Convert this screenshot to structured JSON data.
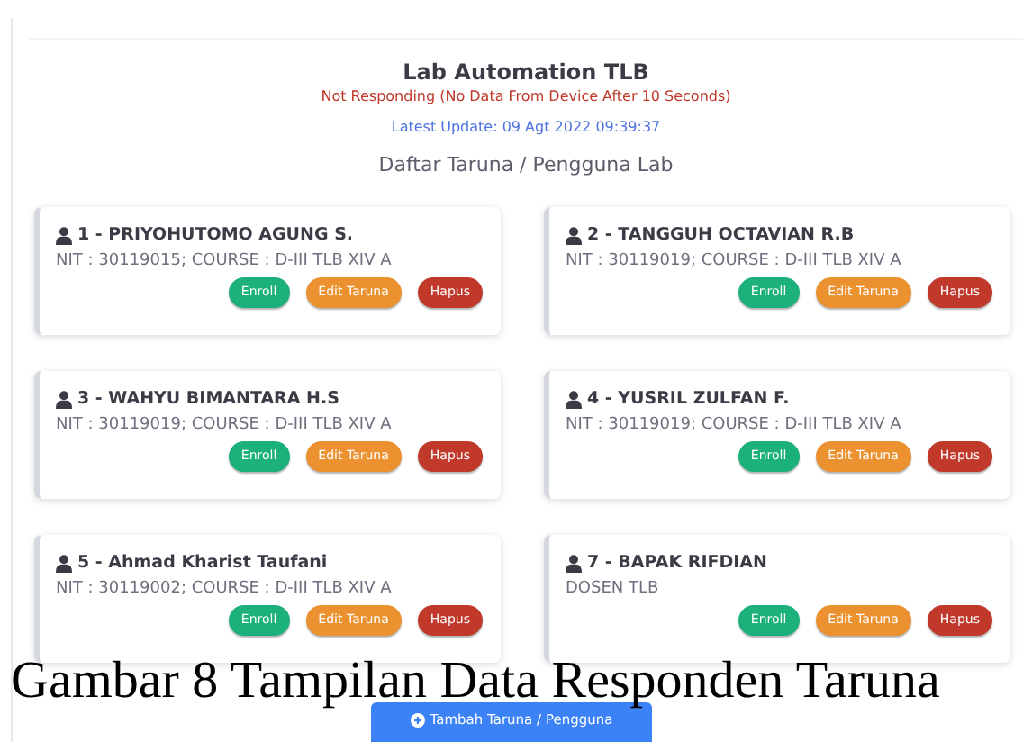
{
  "header": {
    "title": "Lab Automation TLB",
    "status": "Not Responding (No Data From Device After 10 Seconds)",
    "latest_update": "Latest Update: 09 Agt 2022 09:39:37",
    "subtitle": "Daftar Taruna / Pengguna Lab"
  },
  "users": [
    {
      "name": "1 - PRIYOHUTOMO AGUNG S.",
      "detail": "NIT : 30119015; COURSE : D-III TLB XIV A",
      "buttons": [
        "Enroll",
        "Edit Taruna",
        "Hapus"
      ]
    },
    {
      "name": "2 - TANGGUH OCTAVIAN R.B",
      "detail": "NIT : 30119019; COURSE : D-III TLB XIV A",
      "buttons": [
        "Enroll",
        "Edit Taruna",
        "Hapus"
      ]
    },
    {
      "name": "3 - WAHYU BIMANTARA H.S",
      "detail": "NIT : 30119019; COURSE : D-III TLB XIV A",
      "buttons": [
        "Enroll",
        "Edit Taruna",
        "Hapus"
      ]
    },
    {
      "name": "4 - YUSRIL ZULFAN F.",
      "detail": "NIT : 30119019; COURSE : D-III TLB XIV A",
      "buttons": [
        "Enroll",
        "Edit Taruna",
        "Hapus"
      ]
    },
    {
      "name": "5 - Ahmad Kharist Taufani",
      "detail": "NIT : 30119002; COURSE : D-III TLB XIV A",
      "buttons": [
        "Enroll",
        "Edit Taruna",
        "Hapus"
      ]
    },
    {
      "name": "7 - BAPAK RIFDIAN",
      "detail": "DOSEN TLB",
      "buttons": [
        "Enroll",
        "Edit Taruna",
        "Hapus"
      ]
    }
  ],
  "add_button": "Tambah Taruna / Pengguna",
  "caption": "Gambar 8 Tampilan Data Responden Taruna"
}
